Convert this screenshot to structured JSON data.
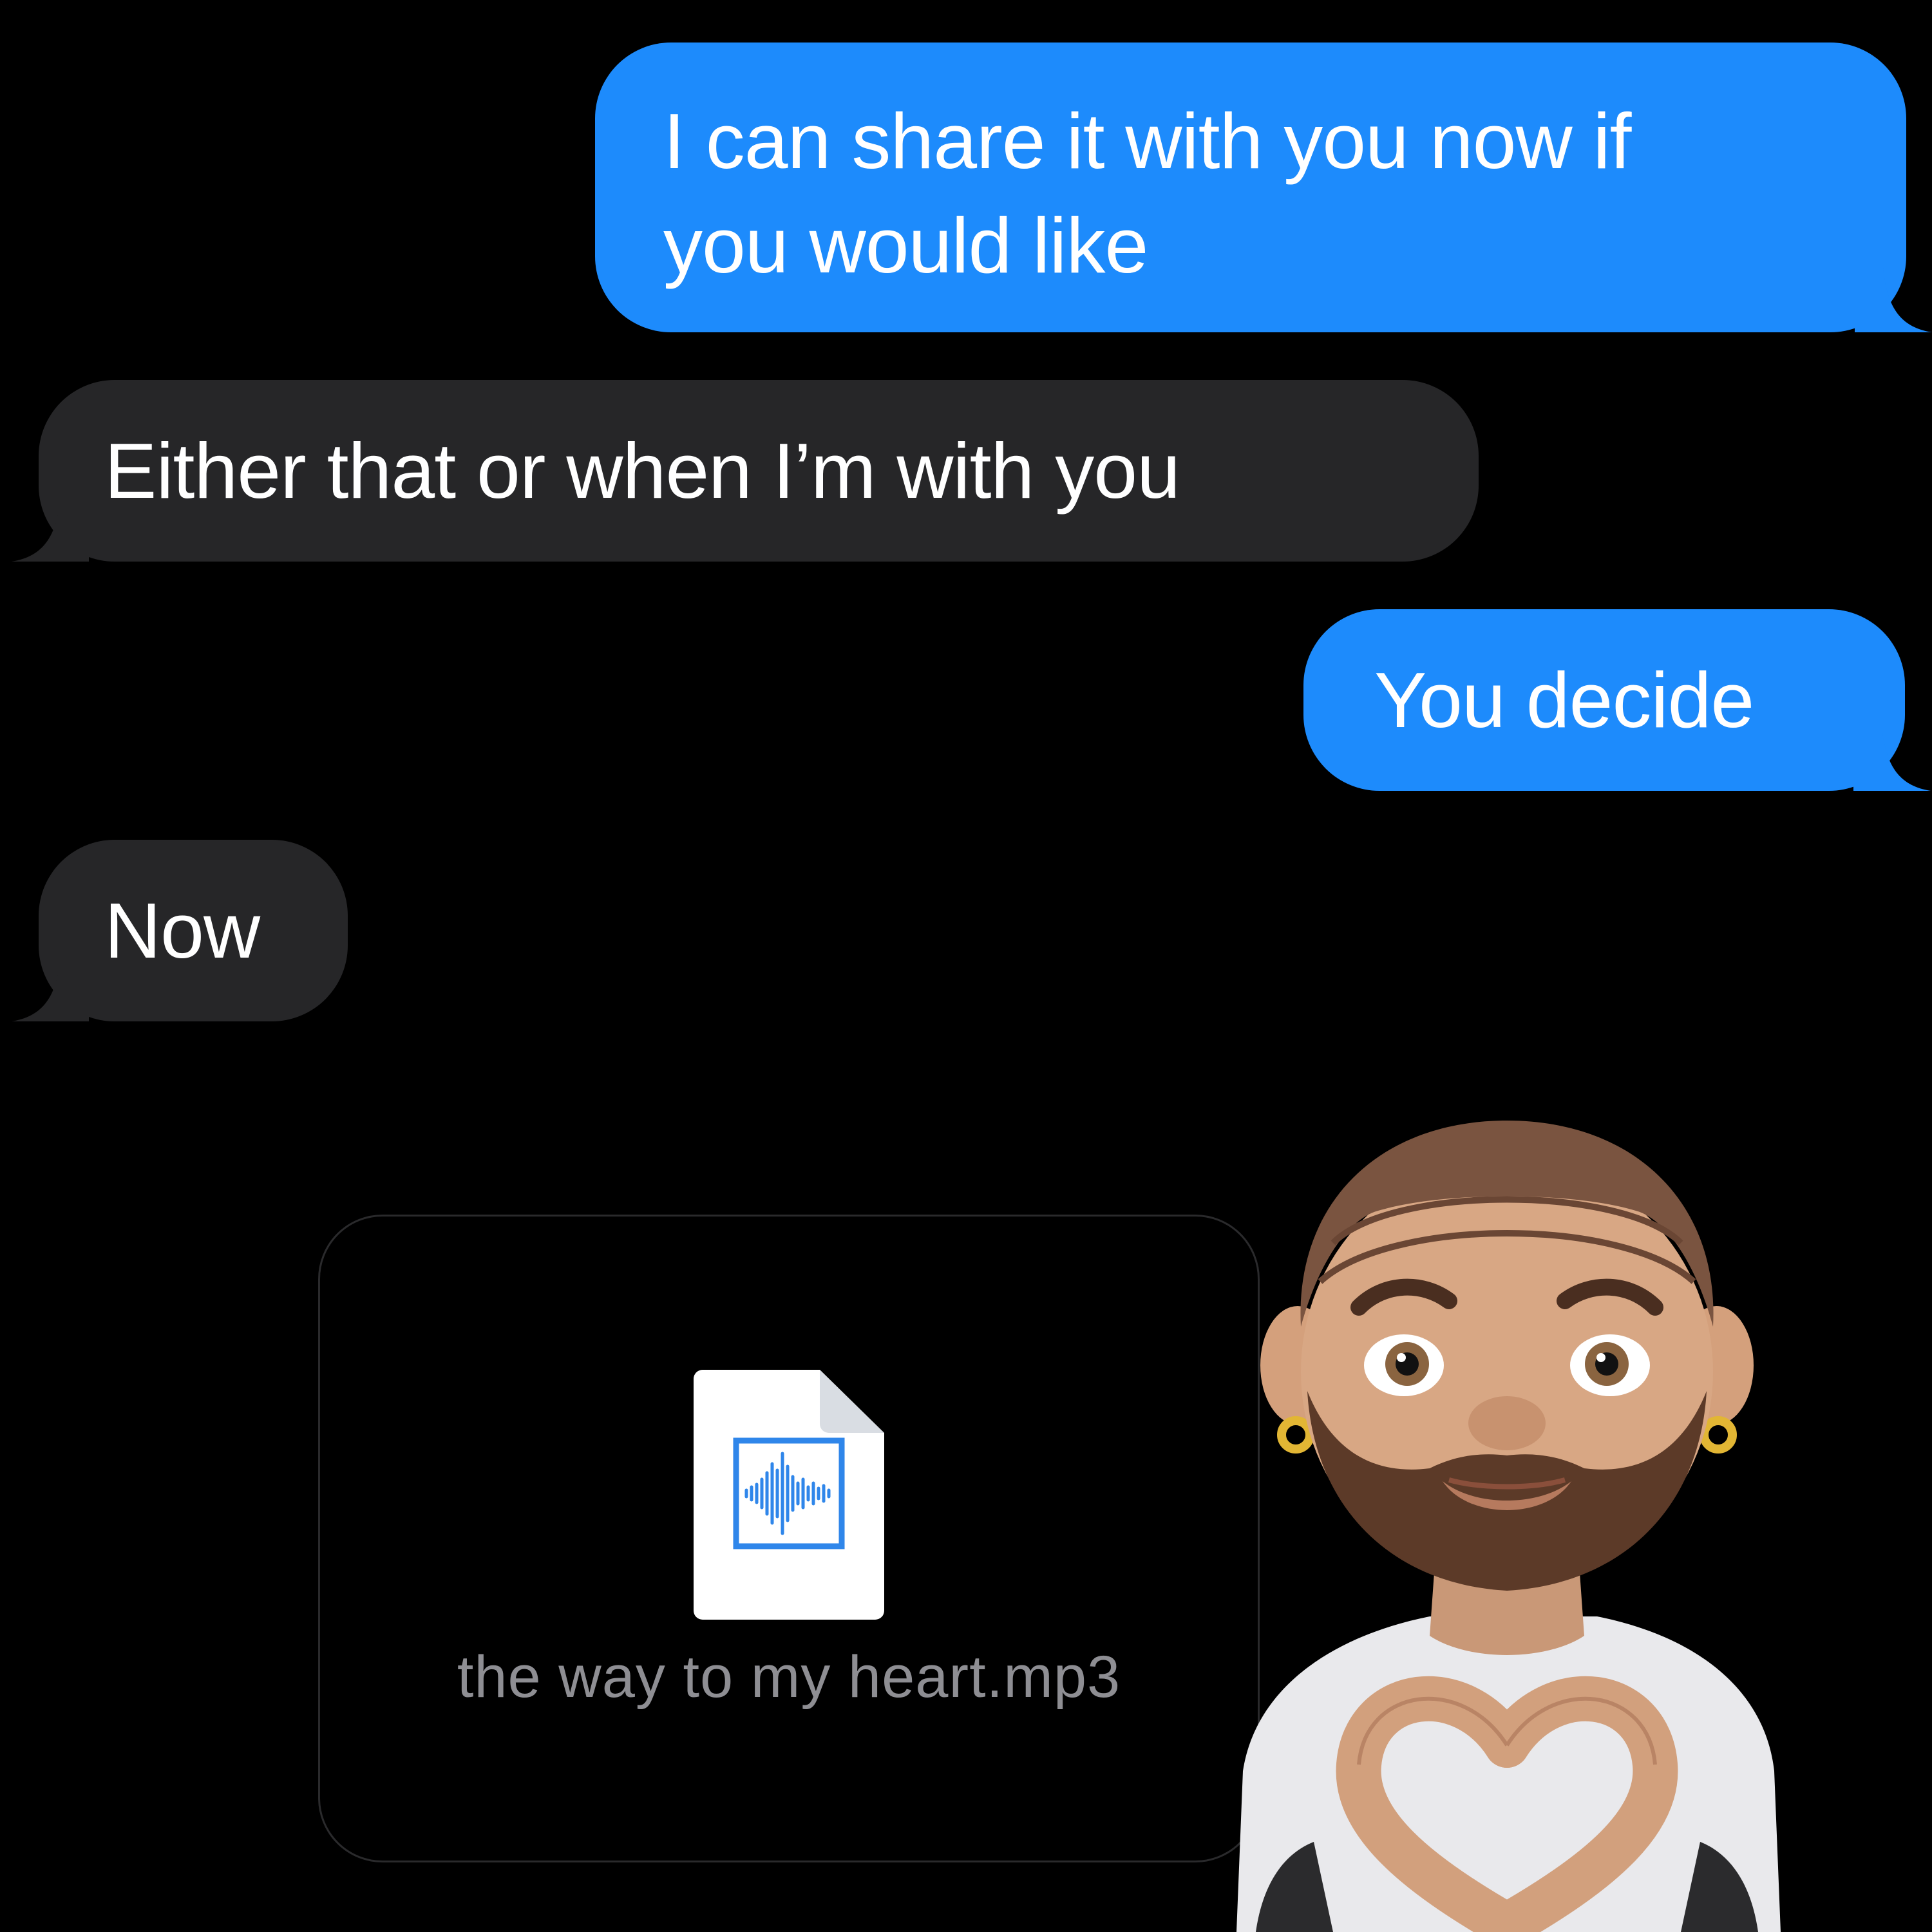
{
  "conversation": {
    "messages": [
      {
        "direction": "outgoing",
        "lines": [
          "I can share it with you now if",
          "you would like"
        ]
      },
      {
        "direction": "incoming",
        "lines": [
          "Either that or when I’m with you"
        ]
      },
      {
        "direction": "outgoing",
        "lines": [
          "You decide"
        ]
      },
      {
        "direction": "incoming",
        "lines": [
          "Now"
        ]
      }
    ],
    "attachment": {
      "file_name": "the way to my heart.mp3",
      "icon": "audio-file-icon"
    },
    "sticker": {
      "icon": "memoji-heart-hands-sticker"
    }
  },
  "colors": {
    "background": "#000000",
    "outgoing_bubble": "#1d8bfc",
    "incoming_bubble": "#262628",
    "bubble_text": "#ffffff",
    "file_name_text": "#8e8e93",
    "audio_wave": "#2f86ea"
  }
}
